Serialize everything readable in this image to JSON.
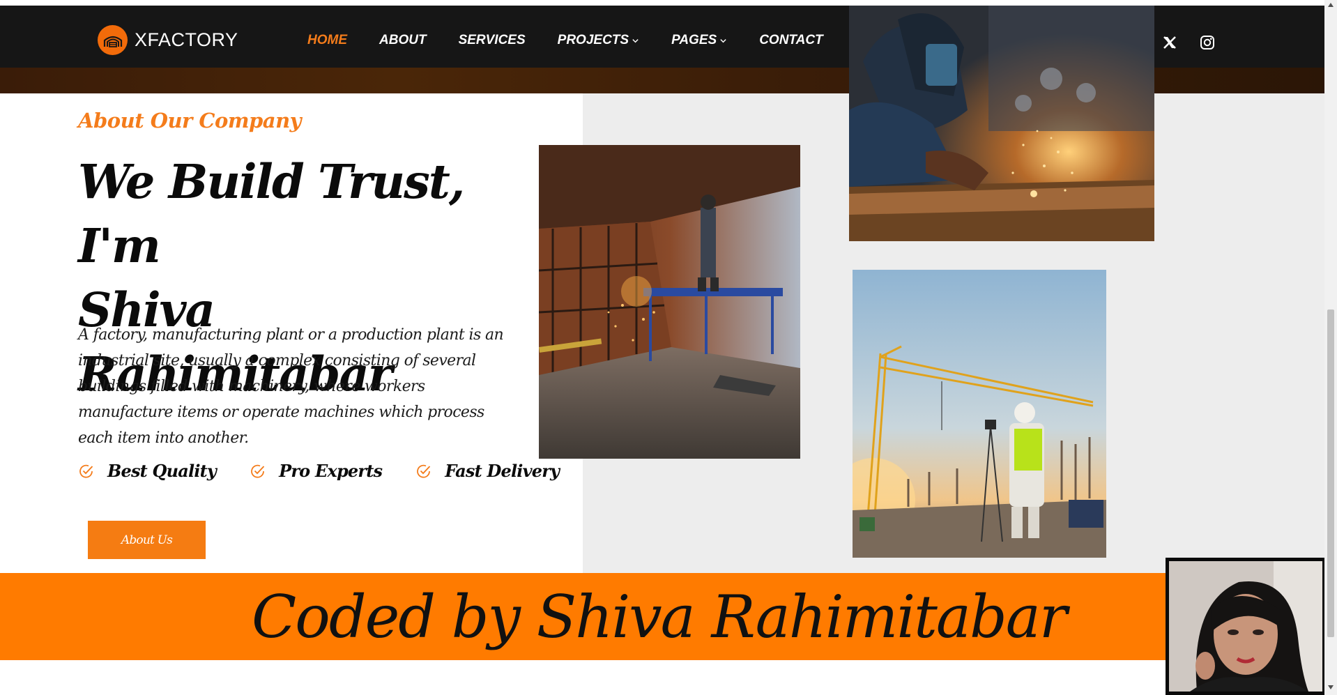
{
  "brand": {
    "name": "XFACTORY",
    "accent": "#f47c1b"
  },
  "nav": {
    "items": [
      {
        "label": "HOME",
        "active": true,
        "dropdown": false
      },
      {
        "label": "ABOUT",
        "active": false,
        "dropdown": false
      },
      {
        "label": "SERVICES",
        "active": false,
        "dropdown": false
      },
      {
        "label": "PROJECTS",
        "active": false,
        "dropdown": true
      },
      {
        "label": "PAGES",
        "active": false,
        "dropdown": true
      },
      {
        "label": "CONTACT",
        "active": false,
        "dropdown": false
      }
    ],
    "social": [
      "x-icon",
      "instagram-icon"
    ]
  },
  "about": {
    "kicker": "About Our Company",
    "headline_line1": "We Build Trust, I'm",
    "headline_line2": "Shiva Rahimitabar",
    "description": "A factory, manufacturing plant or a production plant is an industrial site, usually a complex consisting of several buildings filled with machinery, where workers manufacture items or operate machines which process each item into another.",
    "features": [
      "Best Quality",
      "Pro Experts",
      "Fast Delivery"
    ],
    "button_label": "About Us"
  },
  "banner": {
    "text": "Coded by Shiva Rahimitabar",
    "color": "#ff7b00"
  }
}
